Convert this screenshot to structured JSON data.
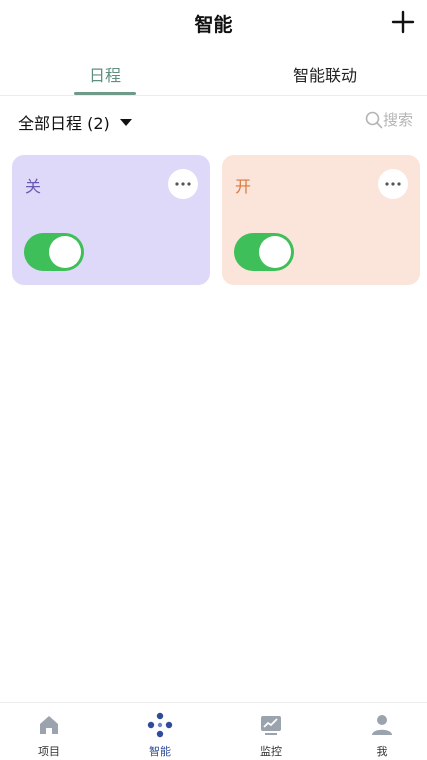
{
  "header": {
    "title": "智能",
    "add_icon": "plus-icon"
  },
  "tabs": [
    {
      "label": "日程",
      "active": true
    },
    {
      "label": "智能联动",
      "active": false
    }
  ],
  "filter": {
    "label": "全部日程 (2)",
    "search_label": "搜索"
  },
  "cards": [
    {
      "label": "关",
      "background": "#ded9f8",
      "label_color": "#6b58b0",
      "toggle_on": true
    },
    {
      "label": "开",
      "background": "#fbe4da",
      "label_color": "#d9793c",
      "toggle_on": true
    }
  ],
  "colors": {
    "accent": "#5f8f7e",
    "toggle": "#3fbf5a",
    "nav_active": "#2f4c9a"
  },
  "bottom_nav": [
    {
      "label": "项目",
      "icon": "home-icon",
      "active": false
    },
    {
      "label": "智能",
      "icon": "smart-dots-icon",
      "active": true
    },
    {
      "label": "监控",
      "icon": "monitor-chart-icon",
      "active": false
    },
    {
      "label": "我",
      "icon": "user-icon",
      "active": false
    }
  ]
}
